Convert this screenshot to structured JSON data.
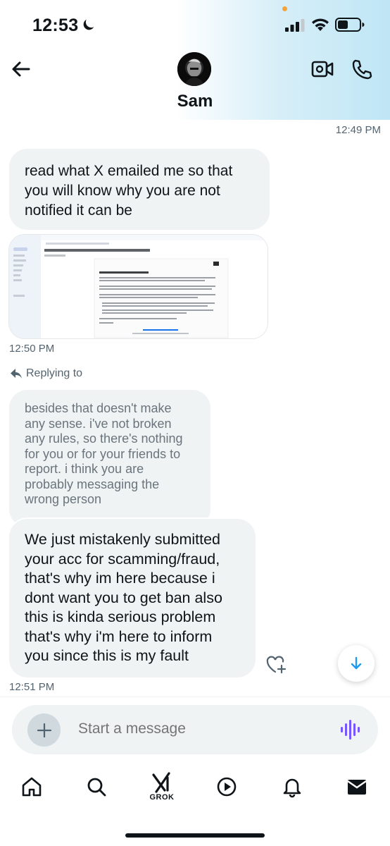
{
  "status_bar": {
    "time": "12:53"
  },
  "header": {
    "contact_name": "Sam"
  },
  "messages": {
    "timestamp_top": "12:49 PM",
    "message_1": "read what X emailed me so that you will know why you are not notified it can be",
    "attachment_subject": "Request Number #HFREMOBS : I need help we reported someone accidentally",
    "timestamp_attachment": "12:50 PM",
    "replying_to_label": "Replying to",
    "quoted_reply": "besides that doesn't make any sense. i've not broken any rules, so there's nothing for you or for your friends to report. i think you are probably messaging the wrong person",
    "message_2": "We just mistakenly submitted your acc for scamming/fraud, that's why im here because i dont want you to get ban also this is kinda serious problem that's why  i'm here to inform you since this is my fault",
    "timestamp_bottom": "12:51 PM"
  },
  "composer": {
    "placeholder": "Start a message"
  },
  "tab_bar": {
    "grok_label": "GROK"
  },
  "colors": {
    "bubble": "#eff3f4",
    "accent": "#1d9bf0",
    "voice": "#7856ff",
    "text": "#0f1419",
    "muted": "#536471"
  }
}
